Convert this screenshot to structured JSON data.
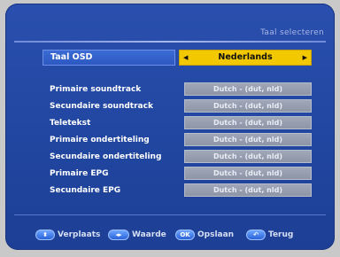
{
  "header": {
    "title": "Taal selecteren"
  },
  "osd": {
    "label": "Taal OSD",
    "value": "Nederlands"
  },
  "settings": [
    {
      "label": "Primaire soundtrack",
      "value": "Dutch - (dut, nld)"
    },
    {
      "label": "Secundaire soundtrack",
      "value": "Dutch - (dut, nld)"
    },
    {
      "label": "Teletekst",
      "value": "Dutch - (dut, nld)"
    },
    {
      "label": "Primaire ondertiteling",
      "value": "Dutch - (dut, nld)"
    },
    {
      "label": "Secundaire ondertiteling",
      "value": "Dutch - (dut, nld)"
    },
    {
      "label": "Primaire EPG",
      "value": "Dutch - (dut, nld)"
    },
    {
      "label": "Secundaire EPG",
      "value": "Dutch - (dut, nld)"
    }
  ],
  "footer": {
    "move": {
      "key": "⬍",
      "label": "Verplaats"
    },
    "value": {
      "key": "◂▸",
      "label": "Waarde"
    },
    "save": {
      "key": "OK",
      "label": "Opslaan"
    },
    "back": {
      "key": "↶",
      "label": "Terug"
    }
  },
  "colors": {
    "background": "#2248a3",
    "highlight": "#f2c800",
    "value_box": "#9fa7b8"
  }
}
